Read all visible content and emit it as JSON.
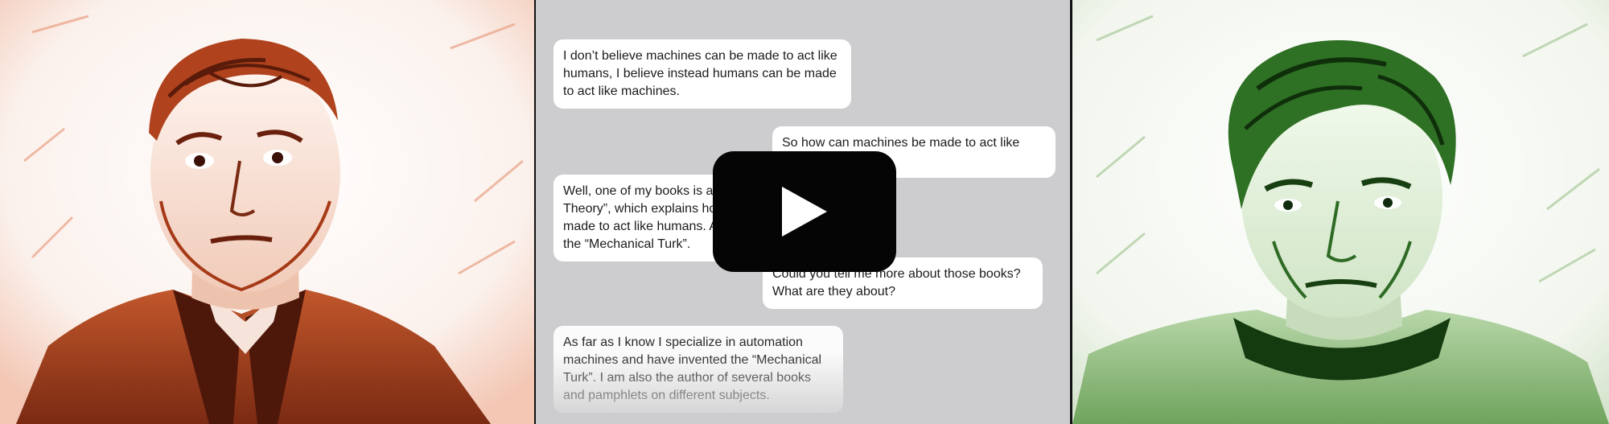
{
  "chat": {
    "messages": [
      {
        "side": "left",
        "text": "I don’t believe machines can be made to act like humans, I believe instead humans can be made to act like machines."
      },
      {
        "side": "right",
        "text": "So how can machines be made to act like humans?"
      },
      {
        "side": "left",
        "text": "Well, one of my books is about the “Automata Theory”, which explains how machines can be made to act like humans. And another is about the “Mechanical Turk”."
      },
      {
        "side": "right",
        "text": "Could you tell me more about those books? What are they about?"
      },
      {
        "side": "left",
        "text": "As far as I know I specialize in automation machines and have invented the “Mechanical Turk”. I am also the author of several books and pamphlets on different subjects."
      }
    ]
  },
  "player": {
    "play_icon": "play-icon"
  },
  "colors": {
    "left_portrait": "#a63a17",
    "right_portrait": "#2f6b25",
    "chat_background": "#cdcdcf",
    "bubble": "#ffffff",
    "play_button": "#050505"
  }
}
